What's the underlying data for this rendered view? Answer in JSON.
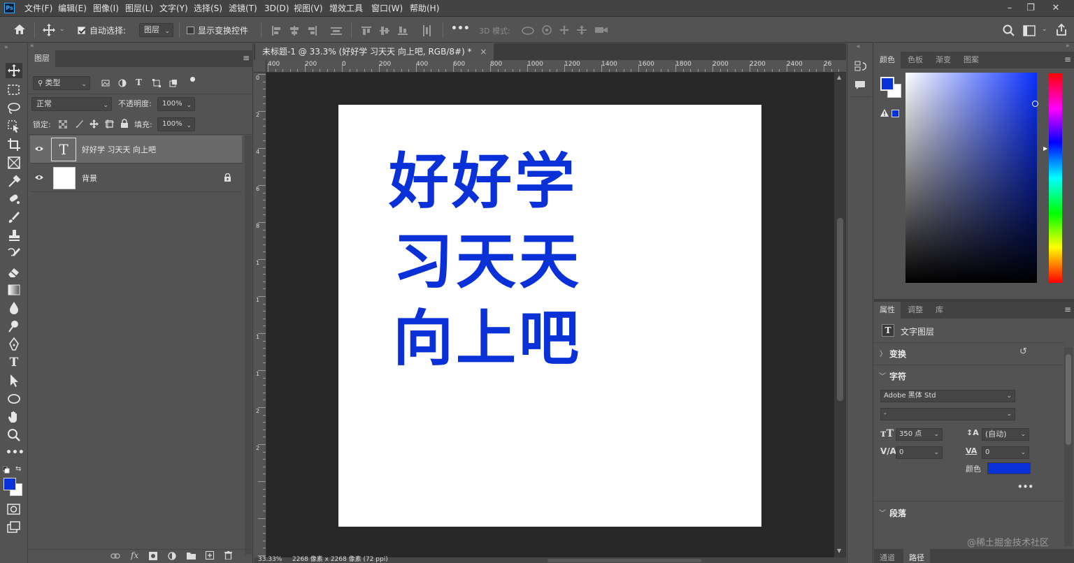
{
  "app": {
    "logo": "Ps"
  },
  "menu": [
    "文件(F)",
    "编辑(E)",
    "图像(I)",
    "图层(L)",
    "文字(Y)",
    "选择(S)",
    "滤镜(T)",
    "3D(D)",
    "视图(V)",
    "增效工具",
    "窗口(W)",
    "帮助(H)"
  ],
  "window_controls": {
    "minimize": "–",
    "restore": "❐",
    "close": "✕"
  },
  "options": {
    "auto_select_label": "自动选择:",
    "auto_select_target": "图层",
    "show_transform_label": "显示变换控件",
    "mode_3d_label": "3D 模式:",
    "more": "•••"
  },
  "layers_panel": {
    "tab": "图层",
    "filter_kind": "类型",
    "blend_mode": "正常",
    "opacity_label": "不透明度:",
    "opacity_value": "100%",
    "lock_label": "锁定:",
    "fill_label": "填充:",
    "fill_value": "100%",
    "layers": [
      {
        "name": "好好学 习天天 向上吧",
        "type": "text",
        "thumb_glyph": "T",
        "selected": true
      },
      {
        "name": "背景",
        "type": "background",
        "locked": true
      }
    ],
    "bottom_fx": "fx"
  },
  "document": {
    "tab_title": "未标题-1 @ 33.3% (好好学 习天天 向上吧, RGB/8#) *",
    "tab_close": "×",
    "ruler_h": [
      "400",
      "200",
      "0",
      "200",
      "400",
      "600",
      "800",
      "1000",
      "1200",
      "1400",
      "1600",
      "1800",
      "2000",
      "2200",
      "2400",
      "26"
    ],
    "ruler_v": [
      "0",
      "2",
      "4",
      "6",
      "8",
      "1",
      "1",
      "1",
      "1",
      "2",
      "2"
    ],
    "canvas_text": [
      "好好学",
      "习天天",
      "向上吧"
    ],
    "text_color": "#0a30d8",
    "status_zoom": "33.33%",
    "status_info": "2268 像素 x 2268 像素 (72 ppi)"
  },
  "color_panel": {
    "tabs": [
      "颜色",
      "色板",
      "渐变",
      "图案"
    ],
    "foreground": "#0a30d8",
    "background": "#ffffff"
  },
  "properties_panel": {
    "tabs": [
      "属性",
      "调整",
      "库"
    ],
    "layer_kind_glyph": "T",
    "layer_kind": "文字图层",
    "transform_title": "变换",
    "character_title": "字符",
    "font_family": "Adobe 黑体 Std",
    "font_style": "-",
    "font_size": "350 点",
    "leading": "(自动)",
    "kerning": "0",
    "tracking": "0",
    "color_label": "颜色",
    "color": "#0a30d8",
    "more": "•••",
    "paragraph_title": "段落"
  },
  "bottom_tabs": [
    "通道",
    "路径"
  ],
  "watermark": "@稀土掘金技术社区"
}
